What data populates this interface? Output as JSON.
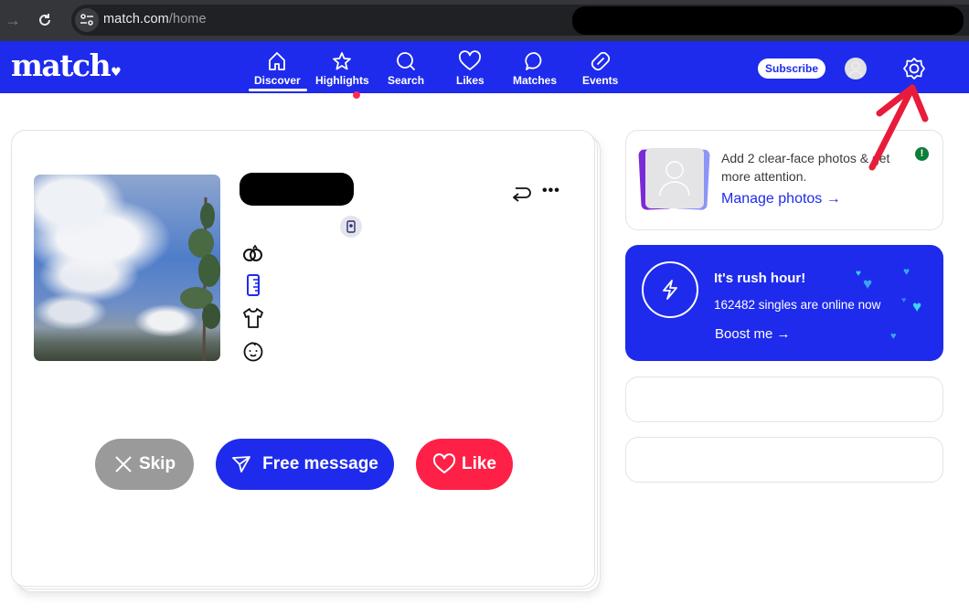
{
  "browser": {
    "url_host": "match.com",
    "url_path": "/home",
    "icons": {
      "back": "arrow-right-icon",
      "reload": "reload-icon",
      "site_info": "tune-icon"
    }
  },
  "appbar": {
    "logo": "match",
    "nav": [
      {
        "label": "Discover",
        "icon": "home-icon",
        "active": true
      },
      {
        "label": "Highlights",
        "icon": "star-icon",
        "notification": true
      },
      {
        "label": "Search",
        "icon": "search-icon"
      },
      {
        "label": "Likes",
        "icon": "heart-icon"
      },
      {
        "label": "Matches",
        "icon": "chat-bubble-icon"
      },
      {
        "label": "Events",
        "icon": "ticket-icon"
      }
    ],
    "subscribe_label": "Subscribe",
    "brand_color": "#1e2bec",
    "notification_color": "#ff2a55"
  },
  "profile": {
    "name": "[redacted]",
    "attribute_icons": [
      "rings-icon",
      "ruler-icon",
      "shirt-icon",
      "baby-face-icon"
    ],
    "actions": {
      "skip_label": "Skip",
      "message_label": "Free message",
      "like_label": "Like"
    },
    "colors": {
      "skip": "#9a9a9a",
      "message": "#1e2bec",
      "like": "#ff2048"
    }
  },
  "sidebar": {
    "photo_prompt": {
      "text": "Add 2 clear-face photos & get more attention.",
      "link": "Manage photos →",
      "alert": "!"
    },
    "rush_hour": {
      "title": "It's rush hour!",
      "subtitle": "162482 singles are online now",
      "link": "Boost me →"
    }
  }
}
